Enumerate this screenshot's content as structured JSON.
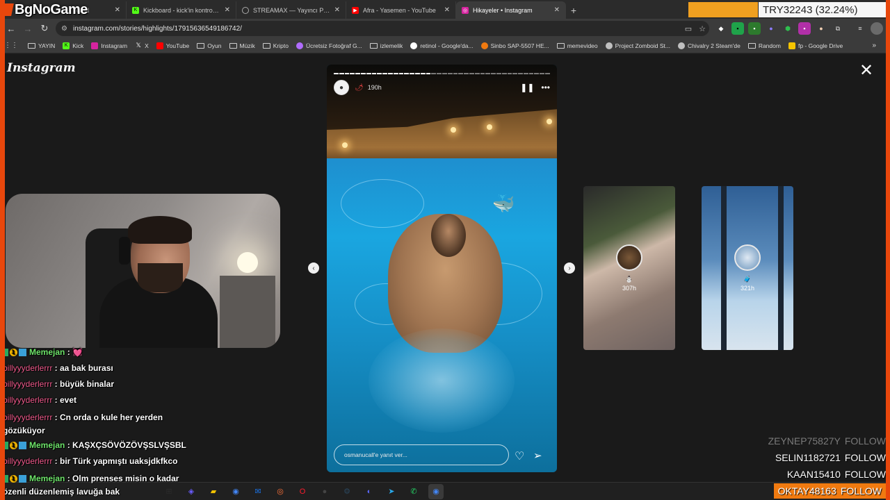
{
  "overlay": {
    "logo_text": "BgNoGame",
    "try_counter": "TRY32243 (32.24%)"
  },
  "tabs": [
    {
      "title": "oard",
      "favicon_color": "#e8470c",
      "favicon_name": "kick-icon"
    },
    {
      "title": "Kickboard - kick'in kontrol pan",
      "favicon_color": "#53fc18",
      "favicon_name": "kick-icon"
    },
    {
      "title": "STREAMAX — Yayıncı Paneli",
      "favicon_color": "#9a9a9a",
      "favicon_name": "globe-icon"
    },
    {
      "title": "Afra - Yasemen - YouTube",
      "favicon_color": "#ff0000",
      "favicon_name": "youtube-icon"
    },
    {
      "title": "Hikayeler • Instagram",
      "favicon_color": "#d6249f",
      "favicon_name": "instagram-icon"
    }
  ],
  "address": {
    "url": "instagram.com/stories/highlights/17915636549186742/"
  },
  "bookmarks": [
    {
      "label": "YAYIN",
      "type": "folder"
    },
    {
      "label": "Kick",
      "type": "link",
      "color": "#53fc18"
    },
    {
      "label": "Instagram",
      "type": "link",
      "color": "#d6249f"
    },
    {
      "label": "X",
      "type": "link",
      "color": "#ffffff"
    },
    {
      "label": "YouTube",
      "type": "link",
      "color": "#ff0000"
    },
    {
      "label": "Oyun",
      "type": "folder"
    },
    {
      "label": "Müzik",
      "type": "folder"
    },
    {
      "label": "Kripto",
      "type": "folder"
    },
    {
      "label": "Ücretsiz Fotoğraf G...",
      "type": "link",
      "color": "#b06cff"
    },
    {
      "label": "izlemelik",
      "type": "folder"
    },
    {
      "label": "retinol - Google'da...",
      "type": "link",
      "color": "#ffffff"
    },
    {
      "label": "Sinbo SAP-5507 HE...",
      "type": "link",
      "color": "#f07a10"
    },
    {
      "label": "memevideo",
      "type": "folder"
    },
    {
      "label": "Project Zomboid St...",
      "type": "link",
      "color": "#c0c0c0"
    },
    {
      "label": "Chivalry 2 Steam'de",
      "type": "link",
      "color": "#c0c0c0"
    },
    {
      "label": "Random",
      "type": "folder"
    },
    {
      "label": "fp - Google Drive",
      "type": "link",
      "color": "#f5c400"
    }
  ],
  "instagram": {
    "logo": "Instagram",
    "story": {
      "time_ago": "190h",
      "reply_placeholder": "osmanucall'e yanıt ver...",
      "progress_total_segments": 40,
      "progress_done_segments": 18
    },
    "previews": [
      {
        "time_ago": "307h"
      },
      {
        "time_ago": "321h"
      }
    ]
  },
  "chat": [
    {
      "user": "Memejan",
      "text": "💓",
      "style": "green",
      "badges": true
    },
    {
      "user": "billyyyderlerrr",
      "text": "aa bak burası",
      "style": "pink",
      "badges": false
    },
    {
      "user": "billyyyderlerrr",
      "text": "büyük binalar",
      "style": "pink",
      "badges": false
    },
    {
      "user": "billyyyderlerrr",
      "text": "evet",
      "style": "pink",
      "badges": false
    },
    {
      "user": "billyyyderlerrr",
      "text": "Cn orda o kule her yerden",
      "style": "pink",
      "badges": false,
      "wrap": "gözüküyor"
    },
    {
      "user": "Memejan",
      "text": "KAŞXÇSÖVÖZÖVŞSLVŞSBL",
      "style": "green",
      "badges": true
    },
    {
      "user": "billyyyderlerrr",
      "text": "bir Türk yapmıştı uaksjdkfkco",
      "style": "pink",
      "badges": false
    },
    {
      "user": "Memejan",
      "text": "Olm prenses misin o kadar",
      "style": "green",
      "badges": true,
      "wrap": "özenli düzenlemiş lavuğa bak"
    }
  ],
  "followers": [
    {
      "name": "ZEYNEP75827Y",
      "label": "FOLLOW"
    },
    {
      "name": "SELIN1182721",
      "label": "FOLLOW"
    },
    {
      "name": "KAAN15410",
      "label": "FOLLOW"
    },
    {
      "name": "OKTAY48163",
      "label": "FOLLOW"
    }
  ],
  "taskbar": [
    {
      "name": "task-view-icon",
      "color": "#2b2b2b"
    },
    {
      "name": "copilot-icon",
      "color": "#6a5cff"
    },
    {
      "name": "file-explorer-icon",
      "color": "#f5c400"
    },
    {
      "name": "chrome-icon",
      "color": "#4285f4"
    },
    {
      "name": "mail-icon",
      "color": "#1a73e8"
    },
    {
      "name": "firefox-icon",
      "color": "#ff7139"
    },
    {
      "name": "opera-icon",
      "color": "#ff1b2d"
    },
    {
      "name": "obs-icon",
      "color": "#444444"
    },
    {
      "name": "steam-icon",
      "color": "#2a475e"
    },
    {
      "name": "discord-icon",
      "color": "#5865f2"
    },
    {
      "name": "telegram-icon",
      "color": "#29a9eb"
    },
    {
      "name": "whatsapp-icon",
      "color": "#25d366"
    },
    {
      "name": "chrome-icon",
      "color": "#4285f4"
    }
  ]
}
